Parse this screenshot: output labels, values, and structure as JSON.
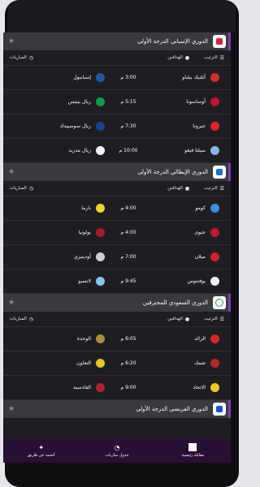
{
  "tabs": {
    "matches": "المباريات",
    "scorers": "الهدافين",
    "standings": "الترتيب"
  },
  "leagues": [
    {
      "name": "الدوري الإسباني الدرجة الأولى",
      "logo_color": "#d6233a",
      "matches": [
        {
          "home": "أتلتيك بيلباو",
          "home_color": "#d0312d",
          "time": "3:00 م",
          "away": "إسبانيول",
          "away_color": "#1e5aa8"
        },
        {
          "home": "أوساسونا",
          "home_color": "#c8102e",
          "time": "5:15 م",
          "away": "ريال بيتيس",
          "away_color": "#0b9a4a"
        },
        {
          "home": "جيرونا",
          "home_color": "#e3222e",
          "time": "7:30 م",
          "away": "ريال سوسييداد",
          "away_color": "#1c3f94"
        },
        {
          "home": "سيلتا فيغو",
          "home_color": "#8ab4e6",
          "time": "10:00 م",
          "away": "ريال مدريد",
          "away_color": "#f2f2f2"
        }
      ]
    },
    {
      "name": "الدوري الإيطالي الدرجة الأولى",
      "logo_color": "#1f6ed4",
      "matches": [
        {
          "home": "كومو",
          "home_color": "#3b8fd9",
          "time": "4:00 م",
          "away": "بارما",
          "away_color": "#f2d22e"
        },
        {
          "home": "جنوى",
          "home_color": "#c0172b",
          "time": "4:00 م",
          "away": "بولونيا",
          "away_color": "#a4192f"
        },
        {
          "home": "ميلان",
          "home_color": "#d3202e",
          "time": "7:00 م",
          "away": "أودينيزي",
          "away_color": "#cfcfcf"
        },
        {
          "home": "يوفنتوس",
          "home_color": "#f5f5f5",
          "time": "9:45 م",
          "away": "لاتسيو",
          "away_color": "#87c6ea"
        }
      ]
    },
    {
      "name": "الدوري السعودي للمحترفين",
      "logo_color": "#ffffff",
      "matches": [
        {
          "home": "الرائد",
          "home_color": "#d62727",
          "time": "6:05 م",
          "away": "الوحدة",
          "away_color": "#b08a3e"
        },
        {
          "home": "ضمك",
          "home_color": "#b3262e",
          "time": "6:20 م",
          "away": "التعاون",
          "away_color": "#e8c52c"
        },
        {
          "home": "الاتحاد",
          "home_color": "#f2c81f",
          "time": "9:00 م",
          "away": "القادسية",
          "away_color": "#b02233"
        }
      ]
    },
    {
      "name": "الدوري الفرنسي الدرجة الأولى",
      "logo_color": "#1c4fd0",
      "matches": []
    }
  ],
  "nav": {
    "home": "مقابلة رئيسية",
    "table": "جدول مباريات",
    "about": "أنحمد عن طريق"
  }
}
